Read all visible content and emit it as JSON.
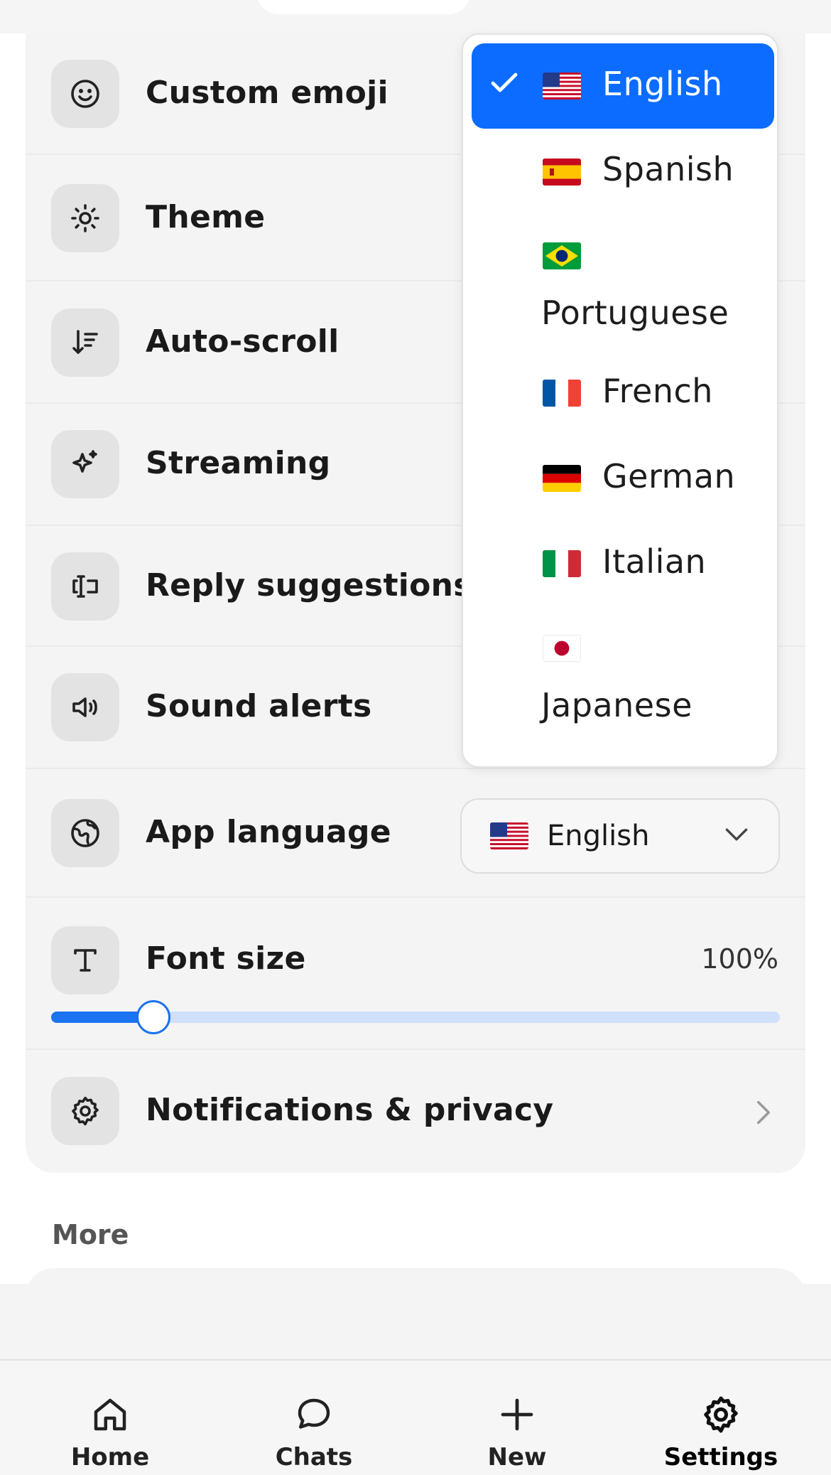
{
  "settings": {
    "rows": [
      {
        "label": "Custom emoji",
        "icon": "smiley-icon"
      },
      {
        "label": "Theme",
        "icon": "sun-icon"
      },
      {
        "label": "Auto-scroll",
        "icon": "sort-down-icon"
      },
      {
        "label": "Streaming",
        "icon": "sparkle-icon"
      },
      {
        "label": "Reply suggestions",
        "icon": "text-cursor-icon"
      },
      {
        "label": "Sound alerts",
        "icon": "speaker-icon"
      },
      {
        "label": "App language",
        "icon": "globe-icon"
      },
      {
        "label": "Font size",
        "icon": "type-icon"
      },
      {
        "label": "Notifications & privacy",
        "icon": "gear-icon"
      }
    ],
    "language_select": {
      "value": "English",
      "flag": "us-flag"
    },
    "font_size": {
      "value_text": "100%",
      "slider_level": 0.14
    }
  },
  "language_dropdown": {
    "options": [
      {
        "label": "English",
        "flag": "us-flag",
        "selected": true
      },
      {
        "label": "Spanish",
        "flag": "spain-flag",
        "selected": false
      },
      {
        "label": "Portuguese",
        "flag": "brazil-flag",
        "selected": false
      },
      {
        "label": "French",
        "flag": "france-flag",
        "selected": false
      },
      {
        "label": "German",
        "flag": "germany-flag",
        "selected": false
      },
      {
        "label": "Italian",
        "flag": "italy-flag",
        "selected": false
      },
      {
        "label": "Japanese",
        "flag": "japan-flag",
        "selected": false
      }
    ]
  },
  "more": {
    "label": "More"
  },
  "tabbar": {
    "tabs": [
      {
        "label": "Home",
        "icon": "home-icon"
      },
      {
        "label": "Chats",
        "icon": "chat-bubble-icon"
      },
      {
        "label": "New",
        "icon": "plus-icon"
      },
      {
        "label": "Settings",
        "icon": "gear-icon"
      }
    ]
  },
  "colors": {
    "accent": "#0b6cff",
    "card_bg": "#f4f4f4",
    "slider_track": "#cfe0fb"
  }
}
